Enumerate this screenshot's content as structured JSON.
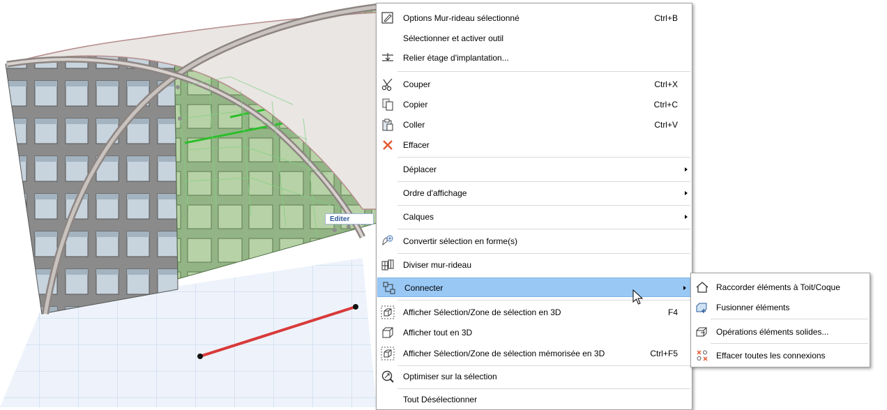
{
  "viewport": {
    "tooltip": "Editer"
  },
  "menu": {
    "items": [
      {
        "label": "Options Mur-rideau sélectionné",
        "shortcut": "Ctrl+B",
        "icon": "curtain-wall-settings-icon"
      },
      {
        "label": "Sélectionner et activer outil",
        "shortcut": "",
        "icon": ""
      },
      {
        "label": "Relier étage d'implantation...",
        "shortcut": "",
        "icon": "relink-story-icon"
      },
      {
        "label": "Couper",
        "shortcut": "Ctrl+X",
        "icon": "scissors-icon"
      },
      {
        "label": "Copier",
        "shortcut": "Ctrl+C",
        "icon": "copy-icon"
      },
      {
        "label": "Coller",
        "shortcut": "Ctrl+V",
        "icon": "paste-icon"
      },
      {
        "label": "Effacer",
        "shortcut": "",
        "icon": "delete-x-icon"
      },
      {
        "label": "Déplacer",
        "shortcut": "",
        "submenu": true
      },
      {
        "label": "Ordre d'affichage",
        "shortcut": "",
        "submenu": true
      },
      {
        "label": "Calques",
        "shortcut": "",
        "submenu": true
      },
      {
        "label": "Convertir sélection en forme(s)",
        "shortcut": "",
        "icon": "convert-shape-icon"
      },
      {
        "label": "Diviser mur-rideau",
        "shortcut": "",
        "icon": "split-curtain-wall-icon"
      },
      {
        "label": "Connecter",
        "shortcut": "",
        "submenu": true,
        "icon": "connect-icon",
        "highlighted": true
      },
      {
        "label": "Afficher Sélection/Zone de sélection en 3D",
        "shortcut": "F4",
        "icon": "show-selection-3d-icon"
      },
      {
        "label": "Afficher tout en 3D",
        "shortcut": "",
        "icon": "show-all-3d-icon"
      },
      {
        "label": "Afficher Sélection/Zone de sélection mémorisée en 3D",
        "shortcut": "Ctrl+F5",
        "icon": "show-stored-selection-3d-icon"
      },
      {
        "label": "Optimiser sur la sélection",
        "shortcut": "",
        "icon": "zoom-selection-icon"
      },
      {
        "label": "Tout Désélectionner",
        "shortcut": "",
        "icon": ""
      }
    ]
  },
  "submenu": {
    "items": [
      {
        "label": "Raccorder éléments à Toit/Coque",
        "icon": "trim-to-roof-icon"
      },
      {
        "label": "Fusionner éléments",
        "icon": "merge-elements-icon"
      },
      {
        "label": "Opérations éléments solides...",
        "icon": "solid-operations-icon"
      },
      {
        "label": "Effacer toutes les connexions",
        "icon": "clear-connections-icon"
      }
    ]
  },
  "colors": {
    "highlight": "#99c8f5",
    "glass_green": "#8fbf7a",
    "selection_red": "#d93a3a"
  }
}
